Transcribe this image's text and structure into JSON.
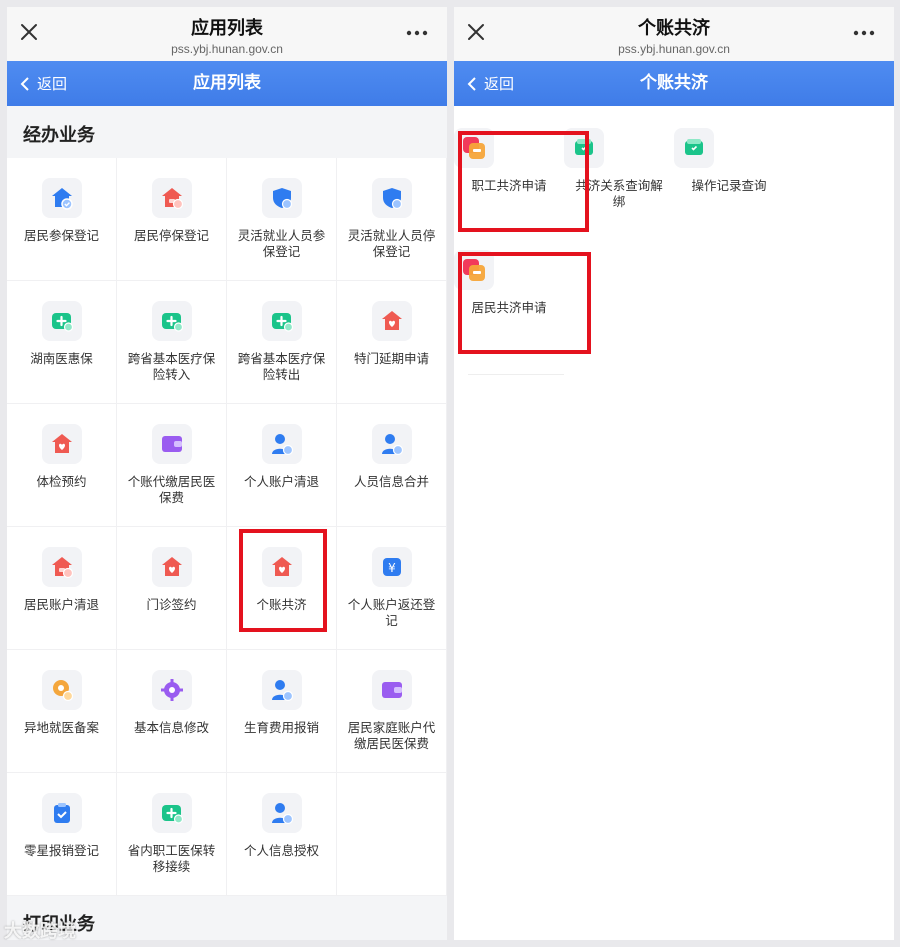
{
  "left": {
    "topbar": {
      "title": "应用列表",
      "url": "pss.ybj.hunan.gov.cn"
    },
    "navbar": {
      "back_label": "返回",
      "title": "应用列表"
    },
    "section1_title": "经办业务",
    "items": [
      {
        "label": "居民参保登记",
        "icon": "shield-house-icon"
      },
      {
        "label": "居民停保登记",
        "icon": "house-icon"
      },
      {
        "label": "灵活就业人员参保登记",
        "icon": "shield-icon"
      },
      {
        "label": "灵活就业人员停保登记",
        "icon": "shield-icon"
      },
      {
        "label": "湖南医惠保",
        "icon": "medical-card-icon"
      },
      {
        "label": "跨省基本医疗保险转入",
        "icon": "medical-card-icon"
      },
      {
        "label": "跨省基本医疗保险转出",
        "icon": "medical-card-icon"
      },
      {
        "label": "特门延期申请",
        "icon": "house-heart-icon"
      },
      {
        "label": "体检预约",
        "icon": "house-heart-icon"
      },
      {
        "label": "个账代缴居民医保费",
        "icon": "wallet-icon"
      },
      {
        "label": "个人账户清退",
        "icon": "person-icon"
      },
      {
        "label": "人员信息合并",
        "icon": "person-icon"
      },
      {
        "label": "居民账户清退",
        "icon": "house-icon"
      },
      {
        "label": "门诊签约",
        "icon": "house-heart-icon"
      },
      {
        "label": "个账共济",
        "icon": "house-heart-icon"
      },
      {
        "label": "个人账户返还登记",
        "icon": "yuan-icon"
      },
      {
        "label": "异地就医备案",
        "icon": "map-pin-icon"
      },
      {
        "label": "基本信息修改",
        "icon": "gear-icon"
      },
      {
        "label": "生育费用报销",
        "icon": "person-icon"
      },
      {
        "label": "居民家庭账户代缴居民医保费",
        "icon": "wallet-icon"
      },
      {
        "label": "零星报销登记",
        "icon": "clipboard-icon"
      },
      {
        "label": "省内职工医保转移接续",
        "icon": "medical-card-icon"
      },
      {
        "label": "个人信息授权",
        "icon": "person-icon"
      }
    ],
    "section2_title": "打印业务"
  },
  "right": {
    "topbar": {
      "title": "个账共济",
      "url": "pss.ybj.hunan.gov.cn"
    },
    "navbar": {
      "back_label": "返回",
      "title": "个账共济"
    },
    "items": [
      {
        "label": "职工共济申请",
        "icon": "cards-icon"
      },
      {
        "label": "共济关系查询解绑",
        "icon": "wallet-green-icon"
      },
      {
        "label": "操作记录查询",
        "icon": "wallet-green-icon"
      },
      {
        "label": "居民共济申请",
        "icon": "cards-icon"
      }
    ]
  },
  "watermark": "大数跨境",
  "colors": {
    "nav_blue": "#4685ee",
    "highlight_red": "#e4121e",
    "icon_blue": "#2f7cf0",
    "icon_red": "#ef5a52",
    "icon_green": "#1bc48a",
    "icon_purple": "#9a5cf0",
    "icon_orange": "#f4a63c"
  }
}
